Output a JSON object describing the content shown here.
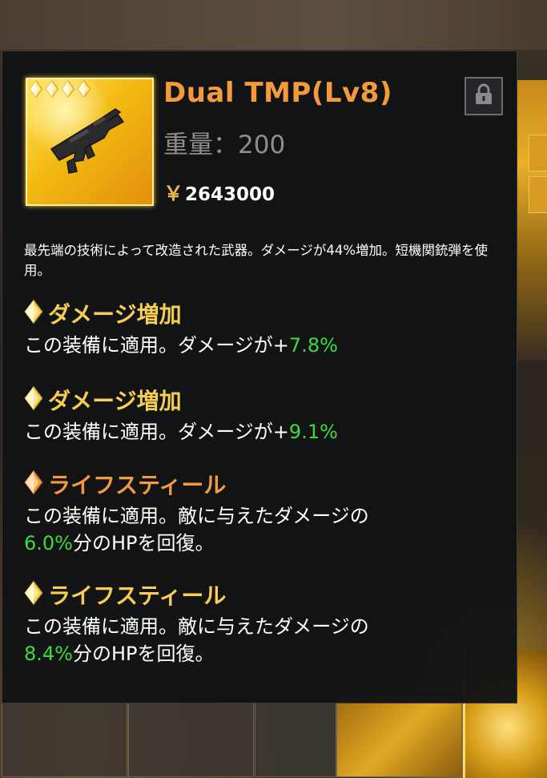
{
  "item": {
    "name": "Dual TMP(Lv8)",
    "weight_label": "重量：",
    "weight_value": "200",
    "price_symbol": "￥",
    "price": "2643000",
    "stars": 4,
    "description": "最先端の技術によって改造された武器。ダメージが44%増加。短機関銃弾を使用。"
  },
  "perks": [
    {
      "name": "ダメージ増加",
      "gem": "gold",
      "pre": "この装備に適用。ダメージが+",
      "value": "7.8%",
      "post": ""
    },
    {
      "name": "ダメージ増加",
      "gem": "gold",
      "pre": "この装備に適用。ダメージが+",
      "value": "9.1%",
      "post": ""
    },
    {
      "name": "ライフスティール",
      "gem": "orange",
      "pre": "この装備に適用。敵に与えたダメージの",
      "value": "6.0%",
      "post": "分のHPを回復。"
    },
    {
      "name": "ライフスティール",
      "gem": "gold",
      "pre": "この装備に適用。敵に与えたダメージの",
      "value": "8.4%",
      "post": "分のHPを回復。"
    }
  ],
  "icons": {
    "lock": "lock-icon",
    "star": "diamond-star-icon",
    "gem": "diamond-gem-icon",
    "weapon": "submachine-gun-icon"
  },
  "colors": {
    "title": "#f39a3d",
    "perk_gold": "#f6cf52",
    "perk_orange": "#f39a3d",
    "value_green": "#3ddc3d"
  }
}
